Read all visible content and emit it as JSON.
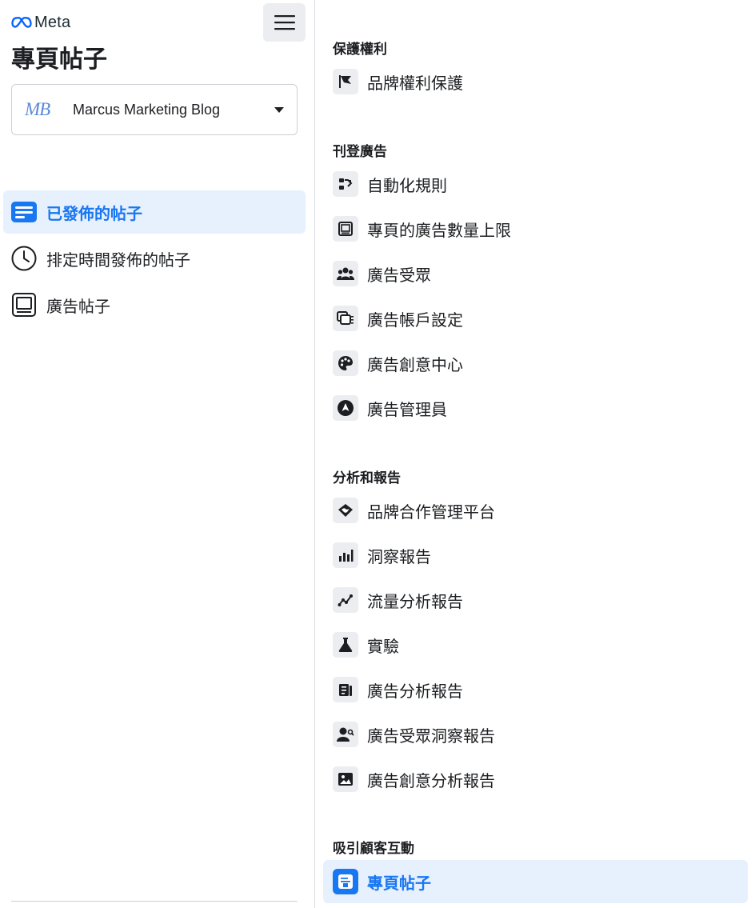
{
  "brand": {
    "logo_text": "Meta"
  },
  "sidebar": {
    "title": "專頁帖子",
    "page_selector": {
      "initials": "MB",
      "name": "Marcus Marketing Blog"
    },
    "items": [
      {
        "label": "已發佈的帖子",
        "icon": "published-posts-icon",
        "active": true
      },
      {
        "label": "排定時間發佈的帖子",
        "icon": "clock-icon",
        "active": false
      },
      {
        "label": "廣告帖子",
        "icon": "ad-posts-icon",
        "active": false
      }
    ]
  },
  "menu": {
    "sections": [
      {
        "title": "保護權利",
        "items": [
          {
            "label": "品牌權利保護",
            "icon": "flag-icon"
          }
        ]
      },
      {
        "title": "刊登廣告",
        "items": [
          {
            "label": "自動化規則",
            "icon": "automation-icon"
          },
          {
            "label": "專頁的廣告數量上限",
            "icon": "ad-limit-icon"
          },
          {
            "label": "廣告受眾",
            "icon": "audience-icon"
          },
          {
            "label": "廣告帳戶設定",
            "icon": "ad-account-icon"
          },
          {
            "label": "廣告創意中心",
            "icon": "palette-icon"
          },
          {
            "label": "廣告管理員",
            "icon": "ads-manager-icon"
          }
        ]
      },
      {
        "title": "分析和報告",
        "items": [
          {
            "label": "品牌合作管理平台",
            "icon": "handshake-icon"
          },
          {
            "label": "洞察報告",
            "icon": "bar-chart-icon"
          },
          {
            "label": "流量分析報告",
            "icon": "trend-icon"
          },
          {
            "label": "實驗",
            "icon": "flask-icon"
          },
          {
            "label": "廣告分析報告",
            "icon": "report-icon"
          },
          {
            "label": "廣告受眾洞察報告",
            "icon": "audience-insights-icon"
          },
          {
            "label": "廣告創意分析報告",
            "icon": "image-report-icon"
          }
        ]
      },
      {
        "title": "吸引顧客互動",
        "items": [
          {
            "label": "專頁帖子",
            "icon": "page-posts-icon",
            "active": true
          }
        ]
      }
    ]
  },
  "colors": {
    "accent": "#1877f2",
    "active_bg": "#e7f0fd",
    "icon_bg": "#ebedf0"
  }
}
